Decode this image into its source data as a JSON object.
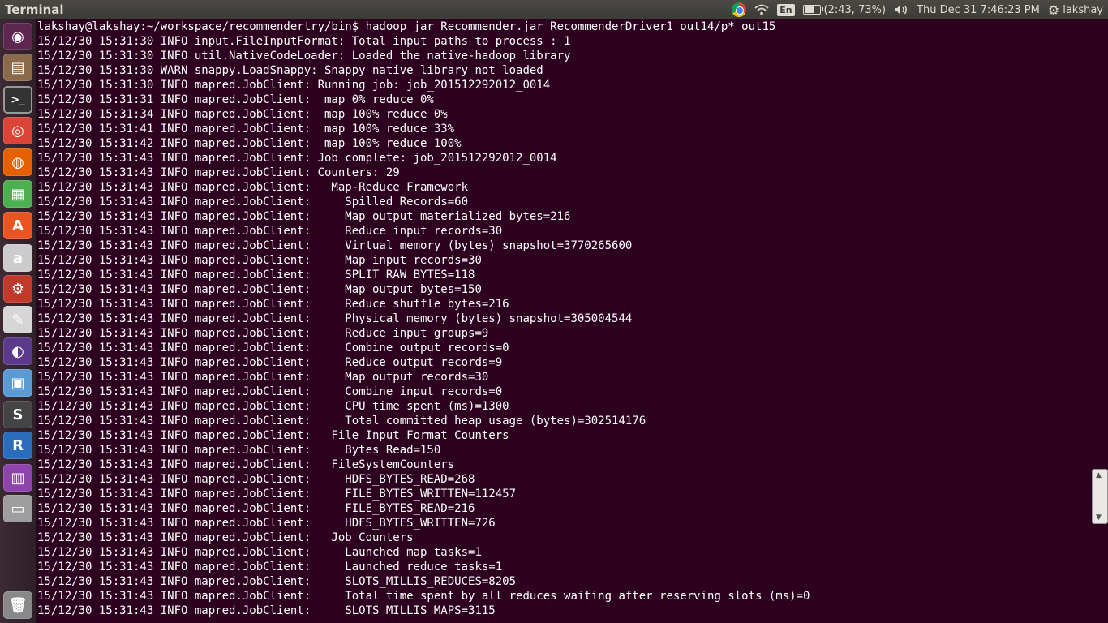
{
  "top_panel": {
    "app_title": "Terminal",
    "keyboard_layout": "En",
    "battery_text": "(2:43, 73%)",
    "battery_percent": 73,
    "datetime": "Thu Dec 31  7:46:23 PM",
    "username": "lakshay",
    "icons": [
      "chrome-icon",
      "wifi-icon",
      "keyboard-icon",
      "battery-icon",
      "volume-icon",
      "gear-icon"
    ]
  },
  "launcher": {
    "items": [
      {
        "name": "dash-home-icon",
        "glyph": "◉",
        "color": "#5e2750"
      },
      {
        "name": "files-icon",
        "glyph": "▤",
        "color": "#8a6a4a"
      },
      {
        "name": "terminal-icon",
        "glyph": ">_",
        "color": "#333333"
      },
      {
        "name": "chrome-icon",
        "glyph": "◎",
        "color": "#db4437"
      },
      {
        "name": "firefox-icon",
        "glyph": "◍",
        "color": "#e66000"
      },
      {
        "name": "libreoffice-icon",
        "glyph": "▦",
        "color": "#4caf50"
      },
      {
        "name": "software-center-icon",
        "glyph": "A",
        "color": "#e95420"
      },
      {
        "name": "amazon-icon",
        "glyph": "a",
        "color": "#cccccc"
      },
      {
        "name": "settings-icon",
        "glyph": "⚙",
        "color": "#c0392b"
      },
      {
        "name": "text-editor-icon",
        "glyph": "✎",
        "color": "#d6d6d6"
      },
      {
        "name": "eclipse-icon",
        "glyph": "◐",
        "color": "#5b3a8c"
      },
      {
        "name": "virtualbox-icon",
        "glyph": "▣",
        "color": "#5b9bd5"
      },
      {
        "name": "sublime-text-icon",
        "glyph": "S",
        "color": "#444444"
      },
      {
        "name": "r-studio-icon",
        "glyph": "R",
        "color": "#2a6ebb"
      },
      {
        "name": "workspace-switcher-icon",
        "glyph": "▥",
        "color": "#8e44ad"
      },
      {
        "name": "drive-icon",
        "glyph": "▭",
        "color": "#9e9e9e"
      },
      {
        "name": "trash-icon",
        "glyph": "🗑",
        "color": "#888888"
      }
    ]
  },
  "terminal": {
    "lines": [
      "lakshay@lakshay:~/workspace/recommendertry/bin$ hadoop jar Recommender.jar RecommenderDriver1 out14/p* out15",
      "15/12/30 15:31:30 INFO input.FileInputFormat: Total input paths to process : 1",
      "15/12/30 15:31:30 INFO util.NativeCodeLoader: Loaded the native-hadoop library",
      "15/12/30 15:31:30 WARN snappy.LoadSnappy: Snappy native library not loaded",
      "15/12/30 15:31:30 INFO mapred.JobClient: Running job: job_201512292012_0014",
      "15/12/30 15:31:31 INFO mapred.JobClient:  map 0% reduce 0%",
      "15/12/30 15:31:34 INFO mapred.JobClient:  map 100% reduce 0%",
      "15/12/30 15:31:41 INFO mapred.JobClient:  map 100% reduce 33%",
      "15/12/30 15:31:42 INFO mapred.JobClient:  map 100% reduce 100%",
      "15/12/30 15:31:43 INFO mapred.JobClient: Job complete: job_201512292012_0014",
      "15/12/30 15:31:43 INFO mapred.JobClient: Counters: 29",
      "15/12/30 15:31:43 INFO mapred.JobClient:   Map-Reduce Framework",
      "15/12/30 15:31:43 INFO mapred.JobClient:     Spilled Records=60",
      "15/12/30 15:31:43 INFO mapred.JobClient:     Map output materialized bytes=216",
      "15/12/30 15:31:43 INFO mapred.JobClient:     Reduce input records=30",
      "15/12/30 15:31:43 INFO mapred.JobClient:     Virtual memory (bytes) snapshot=3770265600",
      "15/12/30 15:31:43 INFO mapred.JobClient:     Map input records=30",
      "15/12/30 15:31:43 INFO mapred.JobClient:     SPLIT_RAW_BYTES=118",
      "15/12/30 15:31:43 INFO mapred.JobClient:     Map output bytes=150",
      "15/12/30 15:31:43 INFO mapred.JobClient:     Reduce shuffle bytes=216",
      "15/12/30 15:31:43 INFO mapred.JobClient:     Physical memory (bytes) snapshot=305004544",
      "15/12/30 15:31:43 INFO mapred.JobClient:     Reduce input groups=9",
      "15/12/30 15:31:43 INFO mapred.JobClient:     Combine output records=0",
      "15/12/30 15:31:43 INFO mapred.JobClient:     Reduce output records=9",
      "15/12/30 15:31:43 INFO mapred.JobClient:     Map output records=30",
      "15/12/30 15:31:43 INFO mapred.JobClient:     Combine input records=0",
      "15/12/30 15:31:43 INFO mapred.JobClient:     CPU time spent (ms)=1300",
      "15/12/30 15:31:43 INFO mapred.JobClient:     Total committed heap usage (bytes)=302514176",
      "15/12/30 15:31:43 INFO mapred.JobClient:   File Input Format Counters",
      "15/12/30 15:31:43 INFO mapred.JobClient:     Bytes Read=150",
      "15/12/30 15:31:43 INFO mapred.JobClient:   FileSystemCounters",
      "15/12/30 15:31:43 INFO mapred.JobClient:     HDFS_BYTES_READ=268",
      "15/12/30 15:31:43 INFO mapred.JobClient:     FILE_BYTES_WRITTEN=112457",
      "15/12/30 15:31:43 INFO mapred.JobClient:     FILE_BYTES_READ=216",
      "15/12/30 15:31:43 INFO mapred.JobClient:     HDFS_BYTES_WRITTEN=726",
      "15/12/30 15:31:43 INFO mapred.JobClient:   Job Counters",
      "15/12/30 15:31:43 INFO mapred.JobClient:     Launched map tasks=1",
      "15/12/30 15:31:43 INFO mapred.JobClient:     Launched reduce tasks=1",
      "15/12/30 15:31:43 INFO mapred.JobClient:     SLOTS_MILLIS_REDUCES=8205",
      "15/12/30 15:31:43 INFO mapred.JobClient:     Total time spent by all reduces waiting after reserving slots (ms)=0",
      "15/12/30 15:31:43 INFO mapred.JobClient:     SLOTS_MILLIS_MAPS=3115"
    ]
  },
  "colors": {
    "terminal_bg": "#2c001e",
    "terminal_fg": "#ffffff",
    "panel_bg": "#3c3b37"
  }
}
